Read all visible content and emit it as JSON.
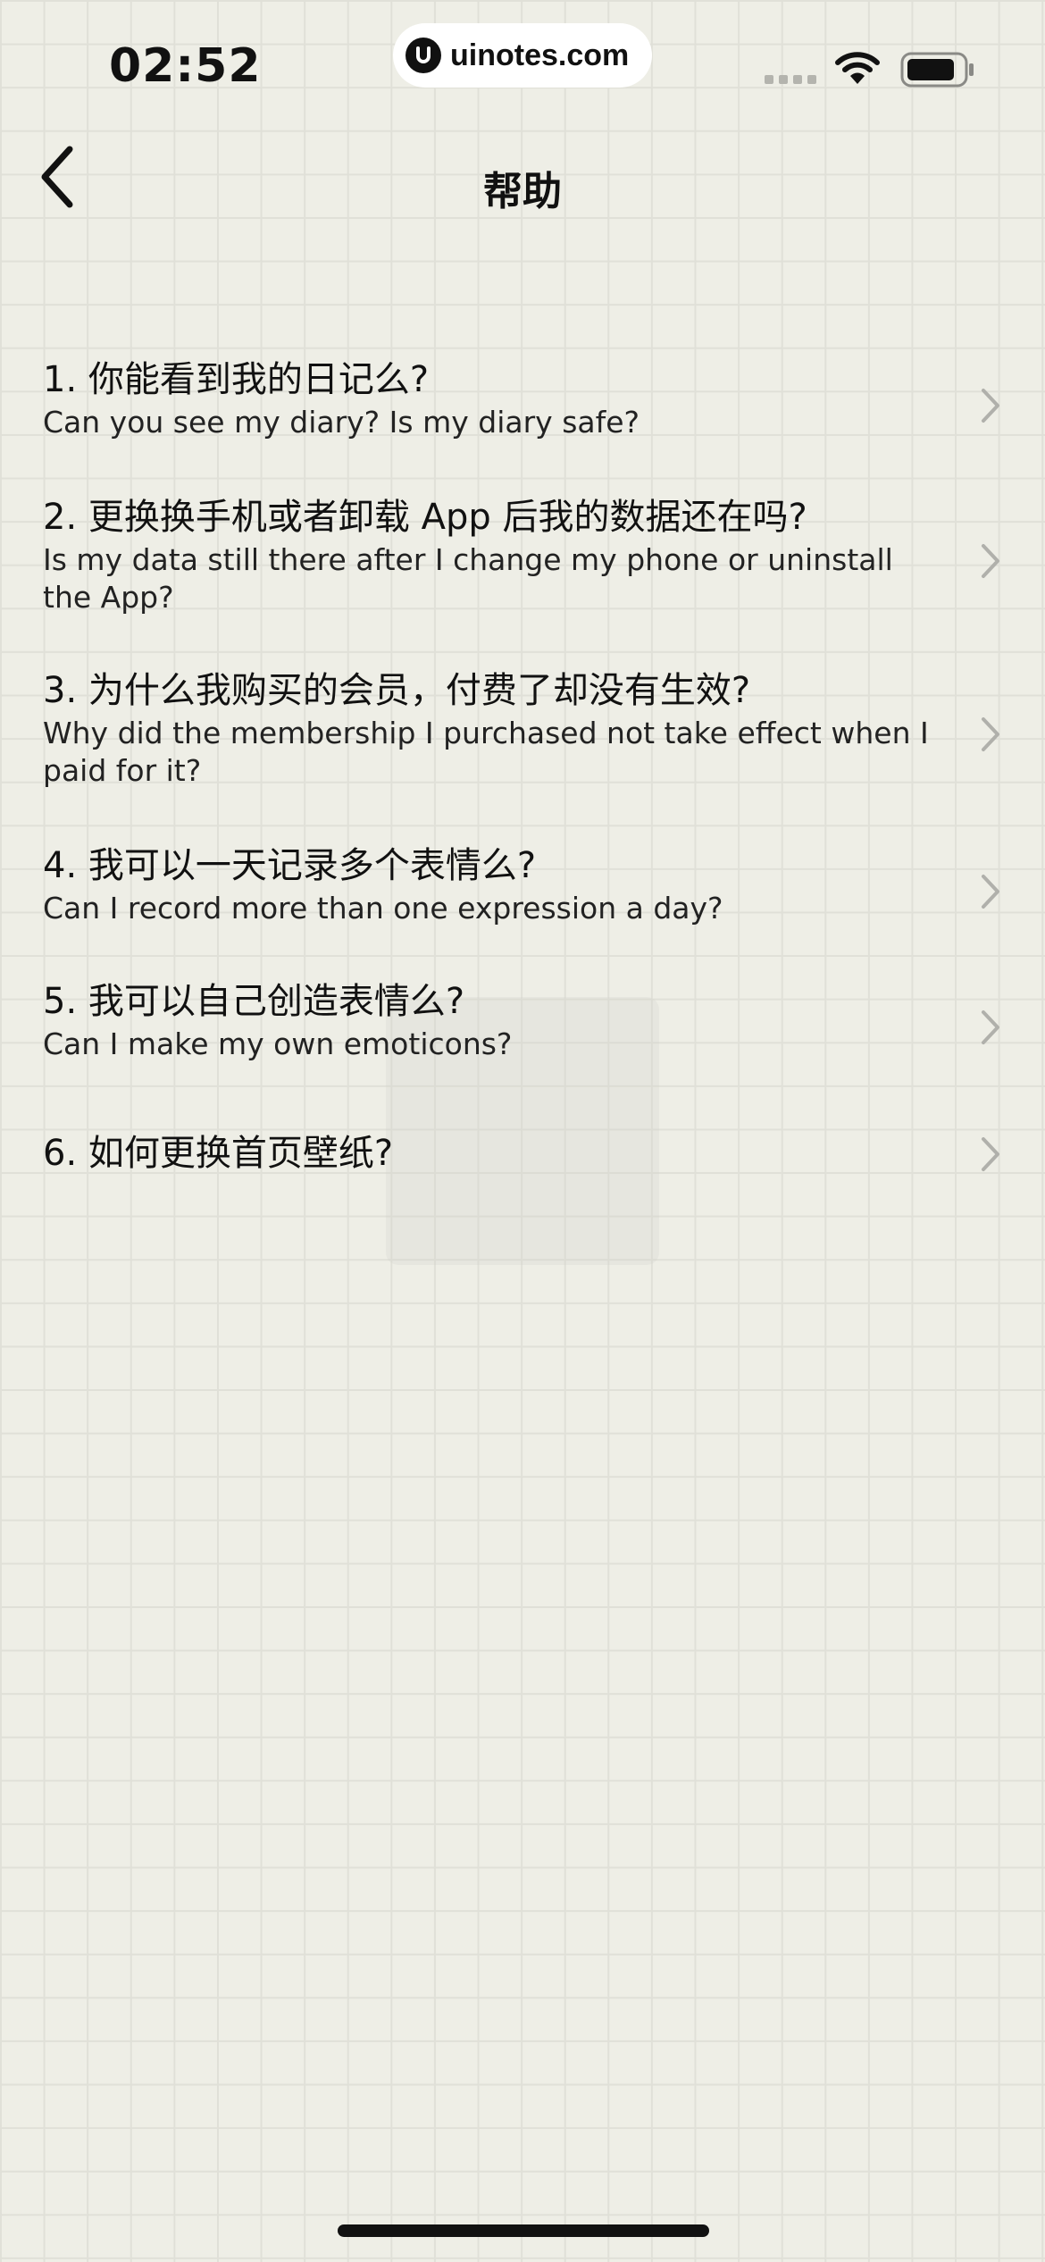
{
  "status_bar": {
    "time": "02:52",
    "watermark": "uinotes.com",
    "icons": [
      "signal-dots-icon",
      "wifi-icon",
      "battery-icon"
    ]
  },
  "nav": {
    "back_icon": "chevron-left-icon",
    "title": "帮助"
  },
  "help_items": [
    {
      "question": "1. 你能看到我的日记么?",
      "answer": "Can you see my diary? Is my diary safe?"
    },
    {
      "question": "2. 更换换手机或者卸载 App 后我的数据还在吗?",
      "answer": "Is my data still there after I change my phone or uninstall the App?"
    },
    {
      "question": "3. 为什么我购买的会员，付费了却没有生效?",
      "answer": "Why did the membership I purchased not take effect when I paid for it?"
    },
    {
      "question": "4. 我可以一天记录多个表情么?",
      "answer": "Can I record more than one expression a day?"
    },
    {
      "question": "5. 我可以自己创造表情么?",
      "answer": "Can I make my own emoticons?"
    },
    {
      "question": "6. 如何更换首页壁纸?",
      "answer": ""
    }
  ],
  "colors": {
    "background": "#eeeee6",
    "grid_line": "#e0e0d8",
    "text": "#111111",
    "chevron": "#b0b0ab"
  }
}
